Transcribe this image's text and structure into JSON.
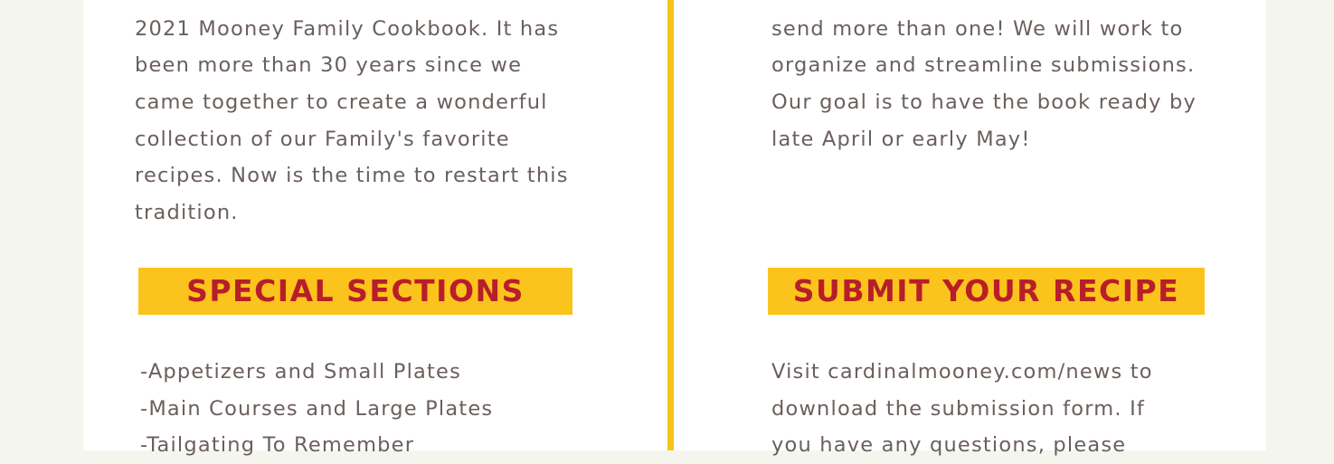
{
  "left_column": {
    "intro_lines": [
      "[clipped top line]",
      "2021 Mooney Family Cookbook. It has",
      "been more than 30 years since we",
      "came together to create a wonderful",
      "collection of our Family's favorite",
      "recipes. Now is the time to restart this",
      "tradition."
    ],
    "special_heading": "SPECIAL SECTIONS",
    "section_items": [
      "-Appetizers and Small Plates",
      "-Main Courses and Large Plates",
      "-Tailgating To Remember"
    ]
  },
  "right_column": {
    "timeline_lines": [
      "[clipped top line]",
      "send more than one! We will work to",
      "organize and streamline submissions.",
      "Our goal is to have the book ready by",
      "late April or early May!"
    ],
    "submit_heading": "SUBMIT YOUR RECIPE",
    "submit_lines": [
      "Visit cardinalmooney.com/news to",
      "download the submission form. If",
      "you have any questions, please"
    ]
  },
  "colors": {
    "background": "#f4f6ee",
    "panel": "#ffffff",
    "accent_yellow": "#fbc41c",
    "heading_red": "#b81e2a",
    "body_text": "#6a5f5c"
  }
}
